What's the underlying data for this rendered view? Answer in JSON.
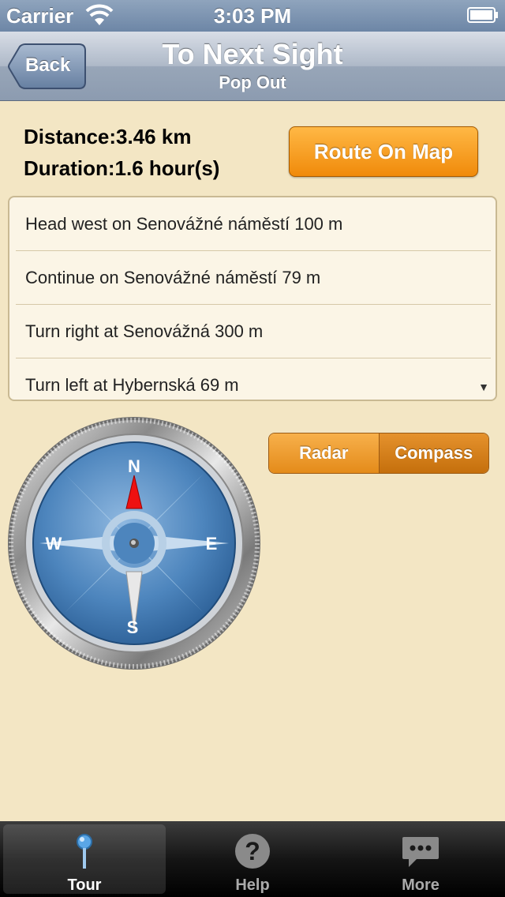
{
  "status_bar": {
    "carrier": "Carrier",
    "time": "3:03 PM"
  },
  "nav": {
    "back_label": "Back",
    "title": "To Next Sight",
    "subtitle": "Pop Out"
  },
  "info": {
    "distance": "Distance:3.46 km",
    "duration": "Duration:1.6 hour(s)",
    "route_button": "Route On Map"
  },
  "directions": [
    "Head west on Senovážné náměstí 100 m",
    "Continue on Senovážné náměstí 79 m",
    "Turn right at Senovážná 300 m",
    "Turn left at Hybernská 69 m"
  ],
  "segment": {
    "radar": "Radar",
    "compass": "Compass",
    "selected": "Compass"
  },
  "compass": {
    "n": "N",
    "s": "S",
    "e": "E",
    "w": "W"
  },
  "tabs": [
    {
      "label": "Tour",
      "icon": "pin-icon",
      "active": true
    },
    {
      "label": "Help",
      "icon": "question-icon",
      "active": false
    },
    {
      "label": "More",
      "icon": "chat-bubble-icon",
      "active": false
    }
  ],
  "colors": {
    "accent_orange": "#f08a0a",
    "background": "#f3e6c4",
    "nav": "#98a6b8"
  }
}
